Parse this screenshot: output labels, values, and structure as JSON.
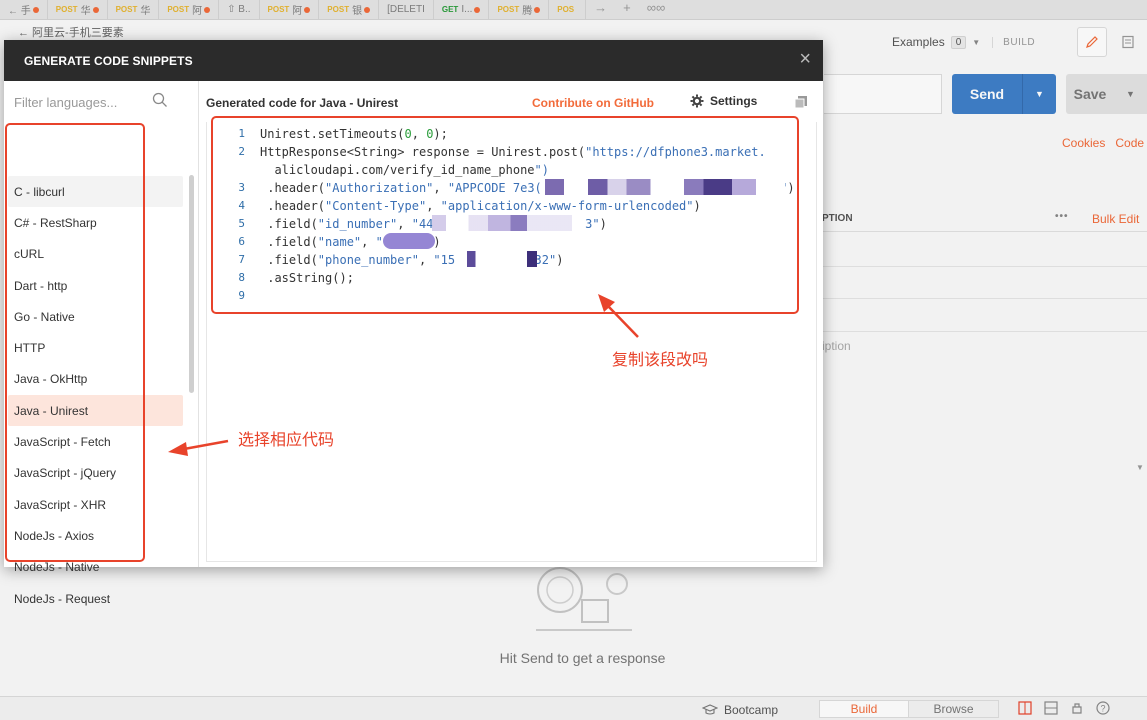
{
  "tabs": [
    {
      "method": "",
      "label": "← 手",
      "dot": true
    },
    {
      "method": "POST",
      "label": "华",
      "dot": true
    },
    {
      "method": "POST",
      "label": "华",
      "dot": false
    },
    {
      "method": "POST",
      "label": "阿",
      "dot": true
    },
    {
      "method": "",
      "label": "⇧ B..",
      "dot": false
    },
    {
      "method": "POST",
      "label": "阿",
      "dot": true
    },
    {
      "method": "POST",
      "label": "银",
      "dot": true
    },
    {
      "method": "",
      "label": "[DELETI",
      "dot": false
    },
    {
      "method": "GET",
      "label": "I...",
      "dot": true
    },
    {
      "method": "POST",
      "label": "腾",
      "dot": true
    },
    {
      "method": "POS",
      "label": "",
      "dot": false
    }
  ],
  "tab_controls": {
    "next": "→",
    "add": "+",
    "more": "∞∞"
  },
  "request": {
    "title": "← 阿里云-手机三要素",
    "examples_label": "Examples",
    "examples_count": "0",
    "build_label": "BUILD",
    "send_label": "Send",
    "save_label": "Save",
    "cookies_label": "Cookies",
    "code_label": "Code",
    "description_header": "DESCRIPTION",
    "column_header": "PTION",
    "bulk_edit_label": "Bulk Edit",
    "more_label": "•••",
    "description_placeholder": "iption",
    "hit_send": "Hit Send to get a response"
  },
  "statusbar": {
    "bootcamp_label": "Bootcamp",
    "build_label": "Build",
    "browse_label": "Browse"
  },
  "modal": {
    "title": "GENERATE CODE SNIPPETS",
    "close_icon": "×",
    "filter_placeholder": "Filter languages...",
    "generated_label": "Generated code for Java - Unirest",
    "contribute_label": "Contribute on GitHub",
    "settings_label": "Settings",
    "languages": [
      "C - libcurl",
      "C# - RestSharp",
      "cURL",
      "Dart - http",
      "Go - Native",
      "HTTP",
      "Java - OkHttp",
      "Java - Unirest",
      "JavaScript - Fetch",
      "JavaScript - jQuery",
      "JavaScript - XHR",
      "NodeJs - Axios",
      "NodeJs - Native",
      "NodeJs - Request"
    ],
    "selected_language": "Java - Unirest",
    "code_lines": [
      {
        "n": "1",
        "code": "Unirest.setTimeouts(0, 0);"
      },
      {
        "n": "2",
        "code": "HttpResponse<String> response = Unirest.post(\"https://dfphone3.market."
      },
      {
        "n": "",
        "code": "  alicloudapi.com/verify_id_name_phone\")"
      },
      {
        "n": "3",
        "code": " .header(\"Authorization\", \"APPCODE 7e3(                              3ce\")"
      },
      {
        "n": "4",
        "code": " .header(\"Content-Type\", \"application/x-www-form-urlencoded\")"
      },
      {
        "n": "5",
        "code": " .field(\"id_number\", \"44                     3\")"
      },
      {
        "n": "6",
        "code": " .field(\"name\", \"      \")"
      },
      {
        "n": "7",
        "code": " .field(\"phone_number\", \"15           32\")"
      },
      {
        "n": "8",
        "code": " .asString();"
      },
      {
        "n": "9",
        "code": ""
      }
    ]
  },
  "annotations": {
    "choose_code": "选择相应代码",
    "copy_code": "复制该段改吗"
  },
  "colors": {
    "accent": "#f26b3a",
    "send_blue": "#3f7fc9",
    "annotation_red": "#e8432b",
    "modal_header": "#2b2b2b",
    "code_string": "#3a6fb5",
    "selected_bg": "#fde5dc"
  }
}
